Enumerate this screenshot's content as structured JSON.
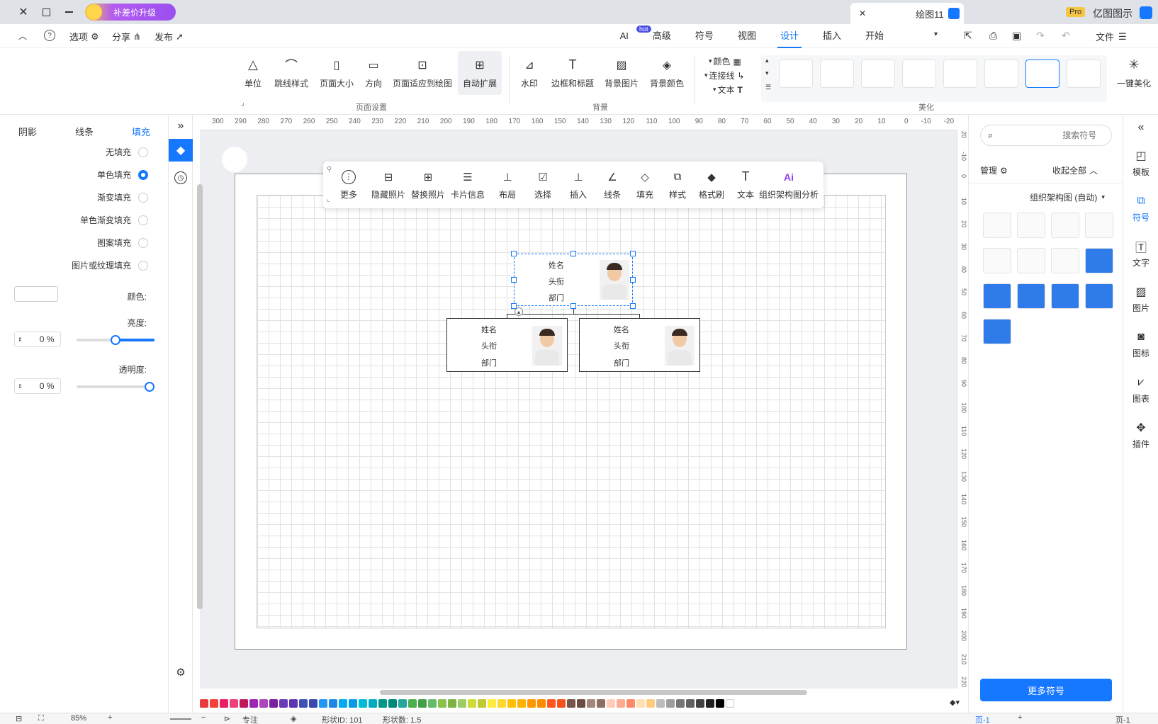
{
  "titlebar": {
    "app_name": "亿图图示",
    "badge": "Pro",
    "doc_tab": "绘图11",
    "upgrade": "补差价升级"
  },
  "menubar": {
    "file": "文件",
    "tabs": [
      "开始",
      "插入",
      "设计",
      "视图",
      "符号",
      "高级",
      "AI"
    ],
    "active_tab": "设计",
    "ai_badge": "hot",
    "publish": "发布",
    "share": "分享",
    "options": "选项"
  },
  "ribbon": {
    "beautify_group": "美化",
    "one_click": "一键美化",
    "theme_opts": [
      "颜色",
      "连接线",
      "文本"
    ],
    "background_group": "背景",
    "background_buttons": [
      "背景颜色",
      "背景图片",
      "边框和标题",
      "水印"
    ],
    "page_group": "页面设置",
    "page_buttons": [
      "自动扩展",
      "页面适应到绘图",
      "方向",
      "页面大小",
      "跳线样式",
      "单位"
    ]
  },
  "symbols_panel": {
    "search_placeholder": "搜索符号",
    "collapse_all": "收起全部",
    "manage": "管理",
    "category": "组织架构图 (自动)",
    "more_button": "更多符号"
  },
  "side_rail": [
    "模板",
    "符号",
    "文字",
    "图片",
    "图标",
    "图表",
    "插件"
  ],
  "fill_panel": {
    "tabs": [
      "填充",
      "线条",
      "阴影"
    ],
    "active_tab": "填充",
    "options": [
      "无填充",
      "单色填充",
      "渐变填充",
      "单色渐变填充",
      "图案填充",
      "图片或纹理填充"
    ],
    "selected_option": "单色填充",
    "color_label": "颜色:",
    "brightness_label": "亮度:",
    "brightness_value": "0 %",
    "transparency_label": "透明度:",
    "transparency_value": "0 %"
  },
  "float_toolbar": [
    "组织架构图分析",
    "文本",
    "格式刷",
    "样式",
    "填充",
    "线条",
    "插入",
    "选择",
    "布局",
    "卡片信息",
    "替换照片",
    "隐藏照片",
    "更多"
  ],
  "cards": [
    {
      "name": "姓名",
      "title": "头衔",
      "dept": "部门"
    },
    {
      "name": "姓名",
      "title": "头衔",
      "dept": "部门"
    },
    {
      "name": "姓名",
      "title": "头衔",
      "dept": "部门"
    }
  ],
  "ruler_top": [
    "-20",
    "-10",
    "0",
    "10",
    "20",
    "30",
    "40",
    "50",
    "60",
    "70",
    "80",
    "90",
    "100",
    "110",
    "120",
    "130",
    "140",
    "150",
    "160",
    "170",
    "180",
    "190",
    "200",
    "210",
    "220",
    "230",
    "240",
    "250",
    "260",
    "270",
    "280",
    "290",
    "300"
  ],
  "ruler_left": [
    "-20",
    "-10",
    "0",
    "10",
    "20",
    "30",
    "40",
    "50",
    "60",
    "70",
    "80",
    "90",
    "100",
    "110",
    "120",
    "130",
    "140",
    "150",
    "160",
    "170",
    "180",
    "190",
    "200",
    "210",
    "220"
  ],
  "statusbar": {
    "page_tab": "页-1",
    "page_label": "页-1",
    "shape_count": "形状数: 1.5",
    "shape_id": "形状ID: 101",
    "focus": "专注",
    "zoom": "85%"
  },
  "colors": {
    "accent": "#1677ff",
    "palette": [
      "#e83b3b",
      "#f44336",
      "#e91e63",
      "#ec407a",
      "#c2185b",
      "#9c27b0",
      "#ab47bc",
      "#7b1fa2",
      "#673ab7",
      "#5e35b1",
      "#3f51b5",
      "#3949ab",
      "#2196f3",
      "#1e88e5",
      "#03a9f4",
      "#039be5",
      "#00bcd4",
      "#00acc1",
      "#009688",
      "#00897b",
      "#26a69a",
      "#4caf50",
      "#43a047",
      "#66bb6a",
      "#8bc34a",
      "#7cb342",
      "#9ccc65",
      "#cddc39",
      "#c0ca33",
      "#ffeb3b",
      "#fdd835",
      "#ffc107",
      "#ffb300",
      "#ff9800",
      "#fb8c00",
      "#ff5722",
      "#f4511e",
      "#795548",
      "#6d4c41",
      "#a1887f",
      "#8d6e63",
      "#ffccbc",
      "#ffab91",
      "#ff8a65",
      "#ffe0b2",
      "#ffcc80",
      "#bdbdbd",
      "#9e9e9e",
      "#757575",
      "#616161",
      "#424242",
      "#212121",
      "#000000",
      "#ffffff"
    ]
  }
}
